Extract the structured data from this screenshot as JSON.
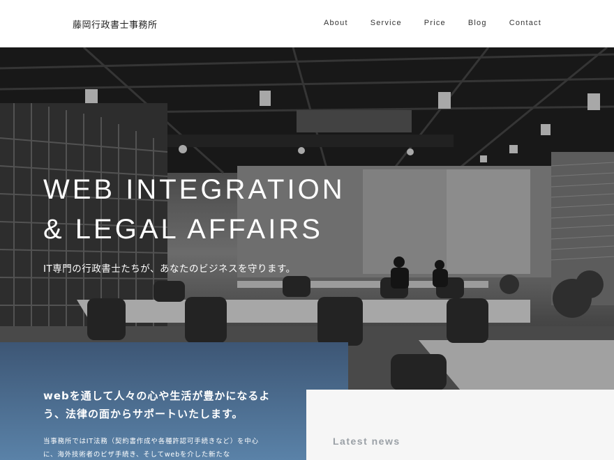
{
  "header": {
    "logo": "藤岡行政書士事務所",
    "nav": [
      "About",
      "Service",
      "Price",
      "Blog",
      "Contact"
    ]
  },
  "hero": {
    "title_line1": "WEB INTEGRATION",
    "title_line2": "& LEGAL AFFAIRS",
    "subtitle": "IT専門の行政書士たちが、あなたのビジネスを守ります。"
  },
  "mission": {
    "heading": "webを通して人々の心や生活が豊かになるよう、法律の面からサポートいたします。",
    "body": "当事務所ではIT法務（契約書作成や各種許認可手続きなど）を中心に、海外技術者のビザ手続き、そしてwebを介した新たな"
  },
  "news": {
    "title": "Latest news"
  },
  "colors": {
    "mission_top": "#3d5675",
    "mission_bottom": "#5a82a8",
    "news_bg": "#f6f6f6",
    "news_title": "#9aa0a6"
  }
}
